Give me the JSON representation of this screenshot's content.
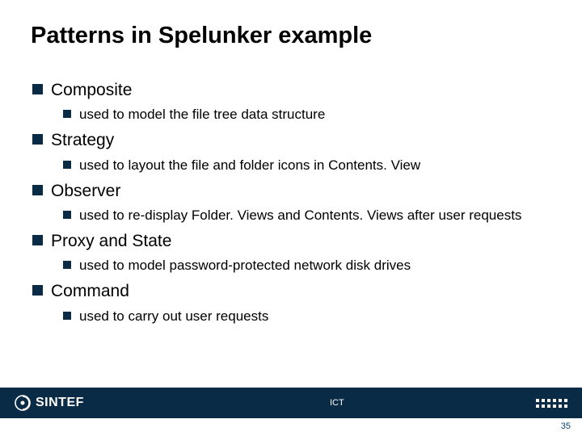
{
  "title": "Patterns in Spelunker example",
  "items": [
    {
      "label": "Composite",
      "sub": [
        {
          "label": "used to model the file tree data structure"
        }
      ]
    },
    {
      "label": "Strategy",
      "sub": [
        {
          "label": "used to layout the file and folder icons in Contents. View"
        }
      ]
    },
    {
      "label": "Observer",
      "sub": [
        {
          "label": "used to re-display Folder. Views and Contents. Views after user requests"
        }
      ]
    },
    {
      "label": "Proxy and State",
      "sub": [
        {
          "label": "used to model password-protected network disk drives"
        }
      ]
    },
    {
      "label": "Command",
      "sub": [
        {
          "label": "used to carry out user requests"
        }
      ]
    }
  ],
  "footer": {
    "brand": "SINTEF",
    "unit": "ICT",
    "page": "35"
  },
  "colors": {
    "brand": "#0a2b45"
  }
}
